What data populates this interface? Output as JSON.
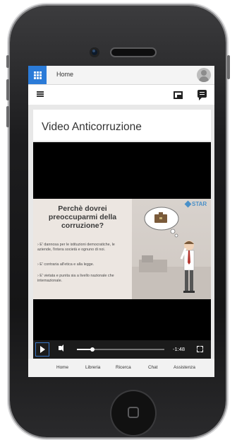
{
  "header": {
    "breadcrumb": "Home"
  },
  "icons": {
    "apps": "grid-icon",
    "avatar": "user-avatar-icon",
    "menu": "list-menu-icon",
    "panel": "panel-icon",
    "chat": "chat-icon",
    "play": "play-icon",
    "volume": "volume-icon",
    "fullscreen": "fullscreen-icon"
  },
  "colors": {
    "accent": "#2b7bd8",
    "video_bg": "#000000",
    "controls_bg": "#1b1b1b"
  },
  "content": {
    "title": "Video Anticorruzione"
  },
  "video": {
    "brand": "STAR",
    "slide_title": "Perchè dovrei preoccuparmi della corruzione?",
    "bullets": [
      "E' dannosa per le istituzioni democratiche, le aziende, l'intera società e ognuno di noi.",
      "E' contraria all'etica e alla legge.",
      "E' vietata e punita sia a livello nazionale che internazionale."
    ],
    "time_remaining": "-1:48",
    "progress_fraction": 0.18
  },
  "bottom_nav": [
    "Home",
    "Libreria",
    "Ricerca",
    "Chat",
    "Assistenza"
  ]
}
